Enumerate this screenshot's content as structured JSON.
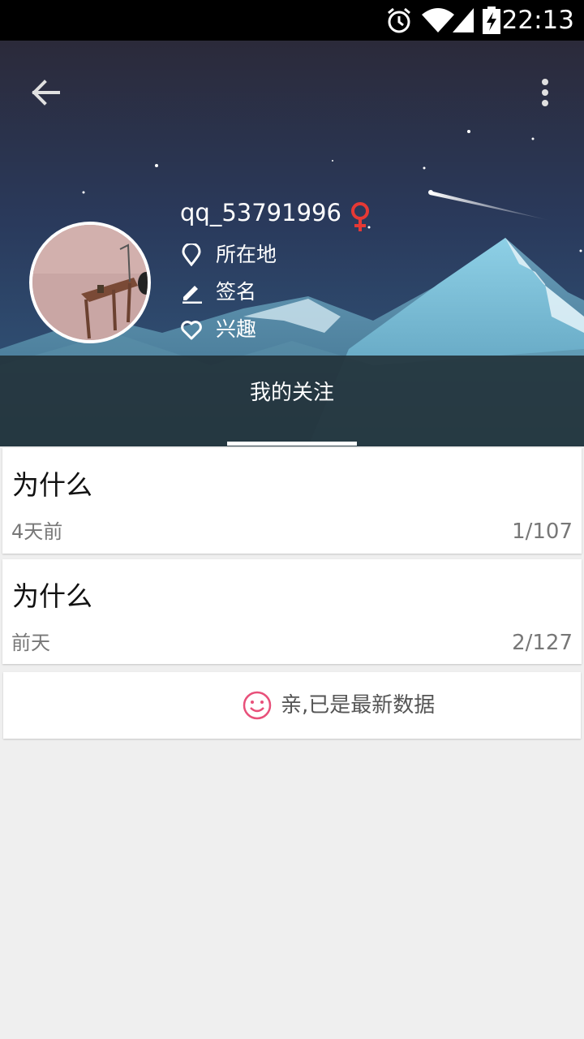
{
  "status_bar": {
    "time": "22:13",
    "icons": [
      "alarm-icon",
      "wifi-icon",
      "signal-icon",
      "battery-charging-icon"
    ]
  },
  "toolbar": {
    "back_icon": "arrow-left-icon",
    "more_icon": "more-vertical-icon"
  },
  "profile": {
    "username": "qq_53791996",
    "gender_icon": "female-icon",
    "gender_color": "#e53935",
    "location_label": "所在地",
    "signature_label": "签名",
    "interests_label": "兴趣"
  },
  "tabs": [
    {
      "label": "我的关注",
      "selected": true
    }
  ],
  "posts": [
    {
      "title": "为什么",
      "time": "4天前",
      "count": "1/107"
    },
    {
      "title": "为什么",
      "time": "前天",
      "count": "2/127"
    }
  ],
  "footer": {
    "message": "亲,已是最新数据",
    "icon": "smile-icon",
    "icon_color": "#e8507a"
  }
}
